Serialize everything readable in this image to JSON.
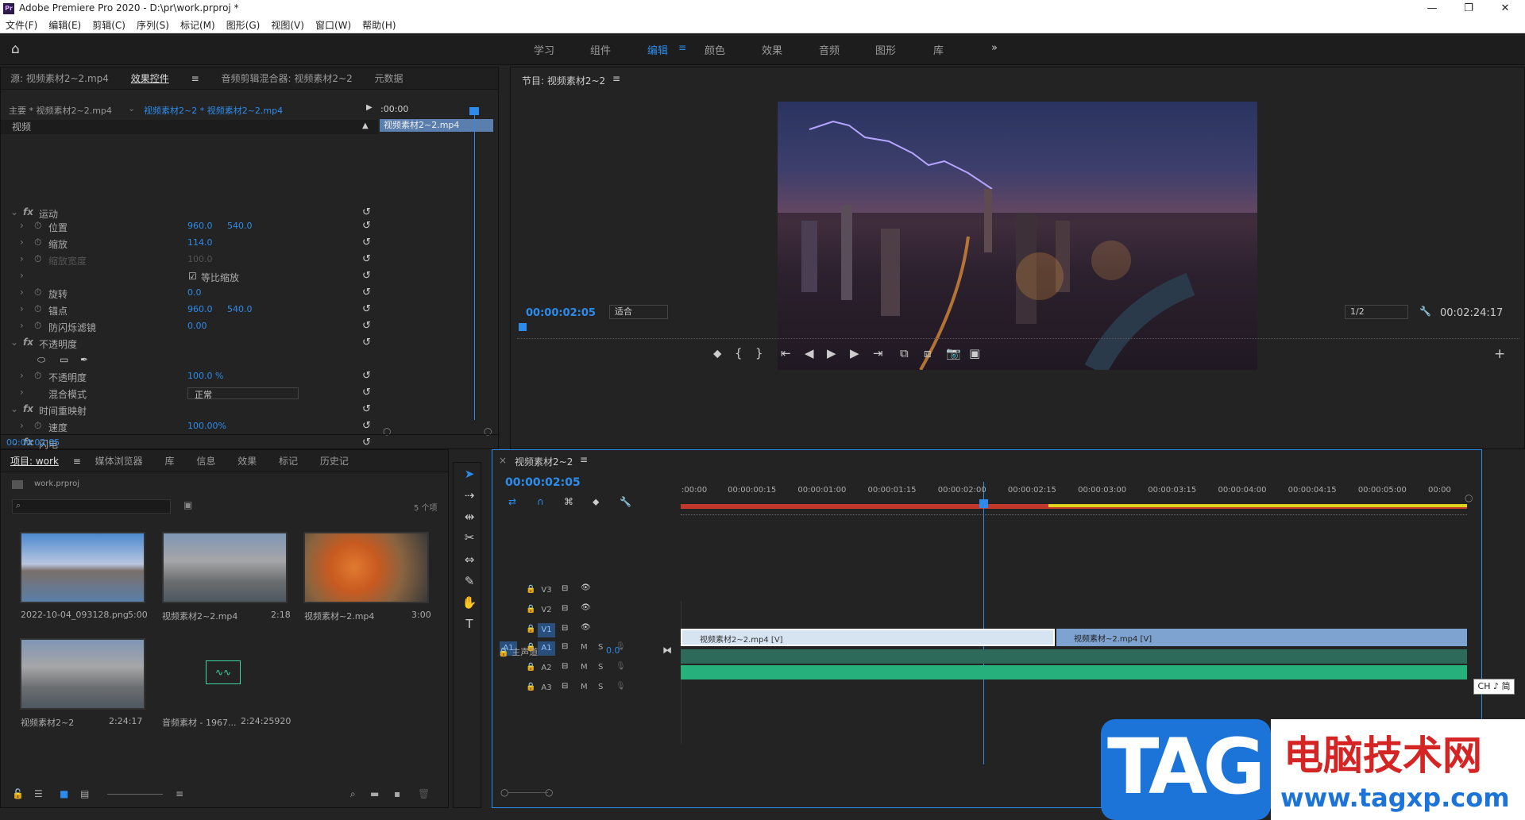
{
  "window": {
    "title": "Adobe Premiere Pro 2020 - D:\\pr\\work.prproj *",
    "minimize": "—",
    "restore": "❐",
    "close": "✕",
    "logo": "Pr"
  },
  "menu": [
    "文件(F)",
    "编辑(E)",
    "剪辑(C)",
    "序列(S)",
    "标记(M)",
    "图形(G)",
    "视图(V)",
    "窗口(W)",
    "帮助(H)"
  ],
  "workspaces": {
    "tabs": [
      "学习",
      "组件",
      "编辑",
      "颜色",
      "效果",
      "音频",
      "图形",
      "库"
    ],
    "active": "编辑",
    "more": "»"
  },
  "source_panel": {
    "tabs": [
      "源: 视频素材2~2.mp4",
      "效果控件",
      "音频剪辑混合器: 视频素材2~2",
      "元数据"
    ],
    "master_label": "主要 * 视频素材2~2.mp4",
    "clip_label": "视频素材2~2 * 视频素材2~2.mp4",
    "timecode_head": ":00:00",
    "clip_chip": "视频素材2~2.mp4",
    "section_video": "视频",
    "rows": [
      {
        "name": "运动",
        "kind": "fx"
      },
      {
        "name": "位置",
        "v1": "960.0",
        "v2": "540.0"
      },
      {
        "name": "缩放",
        "v1": "114.0"
      },
      {
        "name": "缩放宽度",
        "v1": "100.0",
        "dim": true
      },
      {
        "name": "等比缩放",
        "checkbox": true
      },
      {
        "name": "旋转",
        "v1": "0.0"
      },
      {
        "name": "锚点",
        "v1": "960.0",
        "v2": "540.0"
      },
      {
        "name": "防闪烁滤镜",
        "v1": "0.00"
      },
      {
        "name": "不透明度",
        "kind": "fx"
      },
      {
        "name": "shapes",
        "kind": "shapes"
      },
      {
        "name": "不透明度",
        "v1": "100.0 %"
      },
      {
        "name": "混合模式",
        "select": "正常"
      },
      {
        "name": "时间重映射",
        "kind": "fx"
      },
      {
        "name": "速度",
        "v1": "100.00%"
      },
      {
        "name": "闪电",
        "kind": "fx"
      }
    ],
    "footer_tc": "00:00:02:05"
  },
  "program": {
    "title": "节目: 视频素材2~2",
    "timecode": "00:00:02:05",
    "fit": "适合",
    "resolution": "1/2",
    "duration": "00:02:24:17",
    "add": "+"
  },
  "project": {
    "tabs": [
      "项目: work",
      "媒体浏览器",
      "库",
      "信息",
      "效果",
      "标记",
      "历史记"
    ],
    "file": "work.prproj",
    "items_count": "5 个项",
    "items": [
      {
        "name": "2022-10-04_093128.png",
        "dur": "5:00"
      },
      {
        "name": "视频素材2~2.mp4",
        "dur": "2:18"
      },
      {
        "name": "视频素材~2.mp4",
        "dur": "3:00"
      },
      {
        "name": "视频素材2~2",
        "dur": "2:24:17"
      },
      {
        "name": "音频素材 - 1967...",
        "dur": "2:24:25920"
      }
    ]
  },
  "timeline": {
    "title": "视频素材2~2",
    "timecode": "00:00:02:05",
    "ticks": [
      ":00:00",
      "00:00:00:15",
      "00:00:01:00",
      "00:00:01:15",
      "00:00:02:00",
      "00:00:02:15",
      "00:00:03:00",
      "00:00:03:15",
      "00:00:04:00",
      "00:00:04:15",
      "00:00:05:00",
      "00:00"
    ],
    "video_tracks": [
      "V3",
      "V2",
      "V1"
    ],
    "audio_tracks": [
      "A1",
      "A2",
      "A3"
    ],
    "source_patch": "A1",
    "master": "主声道",
    "master_val": "0.0",
    "clip1": "视频素材2~2.mp4 [V]",
    "clip2": "视频素材~2.mp4 [V]",
    "m": "M",
    "s": "S"
  },
  "ime": "CH ♪ 简",
  "watermark": {
    "tag": "TAG",
    "cn": "电脑技术网",
    "url": "www.tagxp.com"
  }
}
